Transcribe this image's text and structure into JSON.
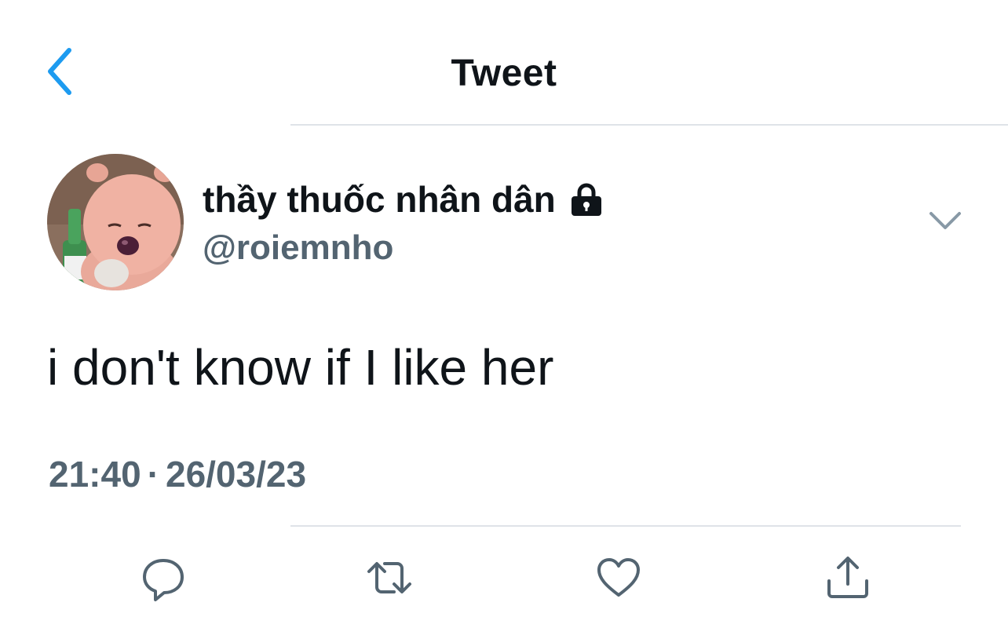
{
  "header": {
    "title": "Tweet",
    "back_icon": "chevron-left-icon",
    "accent": "#1d9bf0"
  },
  "author": {
    "display_name": "thầy thuốc nhân dân",
    "handle": "@roiemnho",
    "protected_icon": "lock-icon",
    "avatar": "avatar-image"
  },
  "tweet": {
    "text": "i don't know if I like her",
    "time": "21:40",
    "separator": "·",
    "date": "26/03/23"
  },
  "actions": [
    {
      "name": "reply",
      "icon": "comment-icon"
    },
    {
      "name": "retweet",
      "icon": "retweet-icon"
    },
    {
      "name": "like",
      "icon": "heart-icon"
    },
    {
      "name": "share",
      "icon": "share-icon"
    }
  ],
  "colors": {
    "text": "#0f1419",
    "muted": "#536471",
    "divider": "#dfe3e8"
  }
}
